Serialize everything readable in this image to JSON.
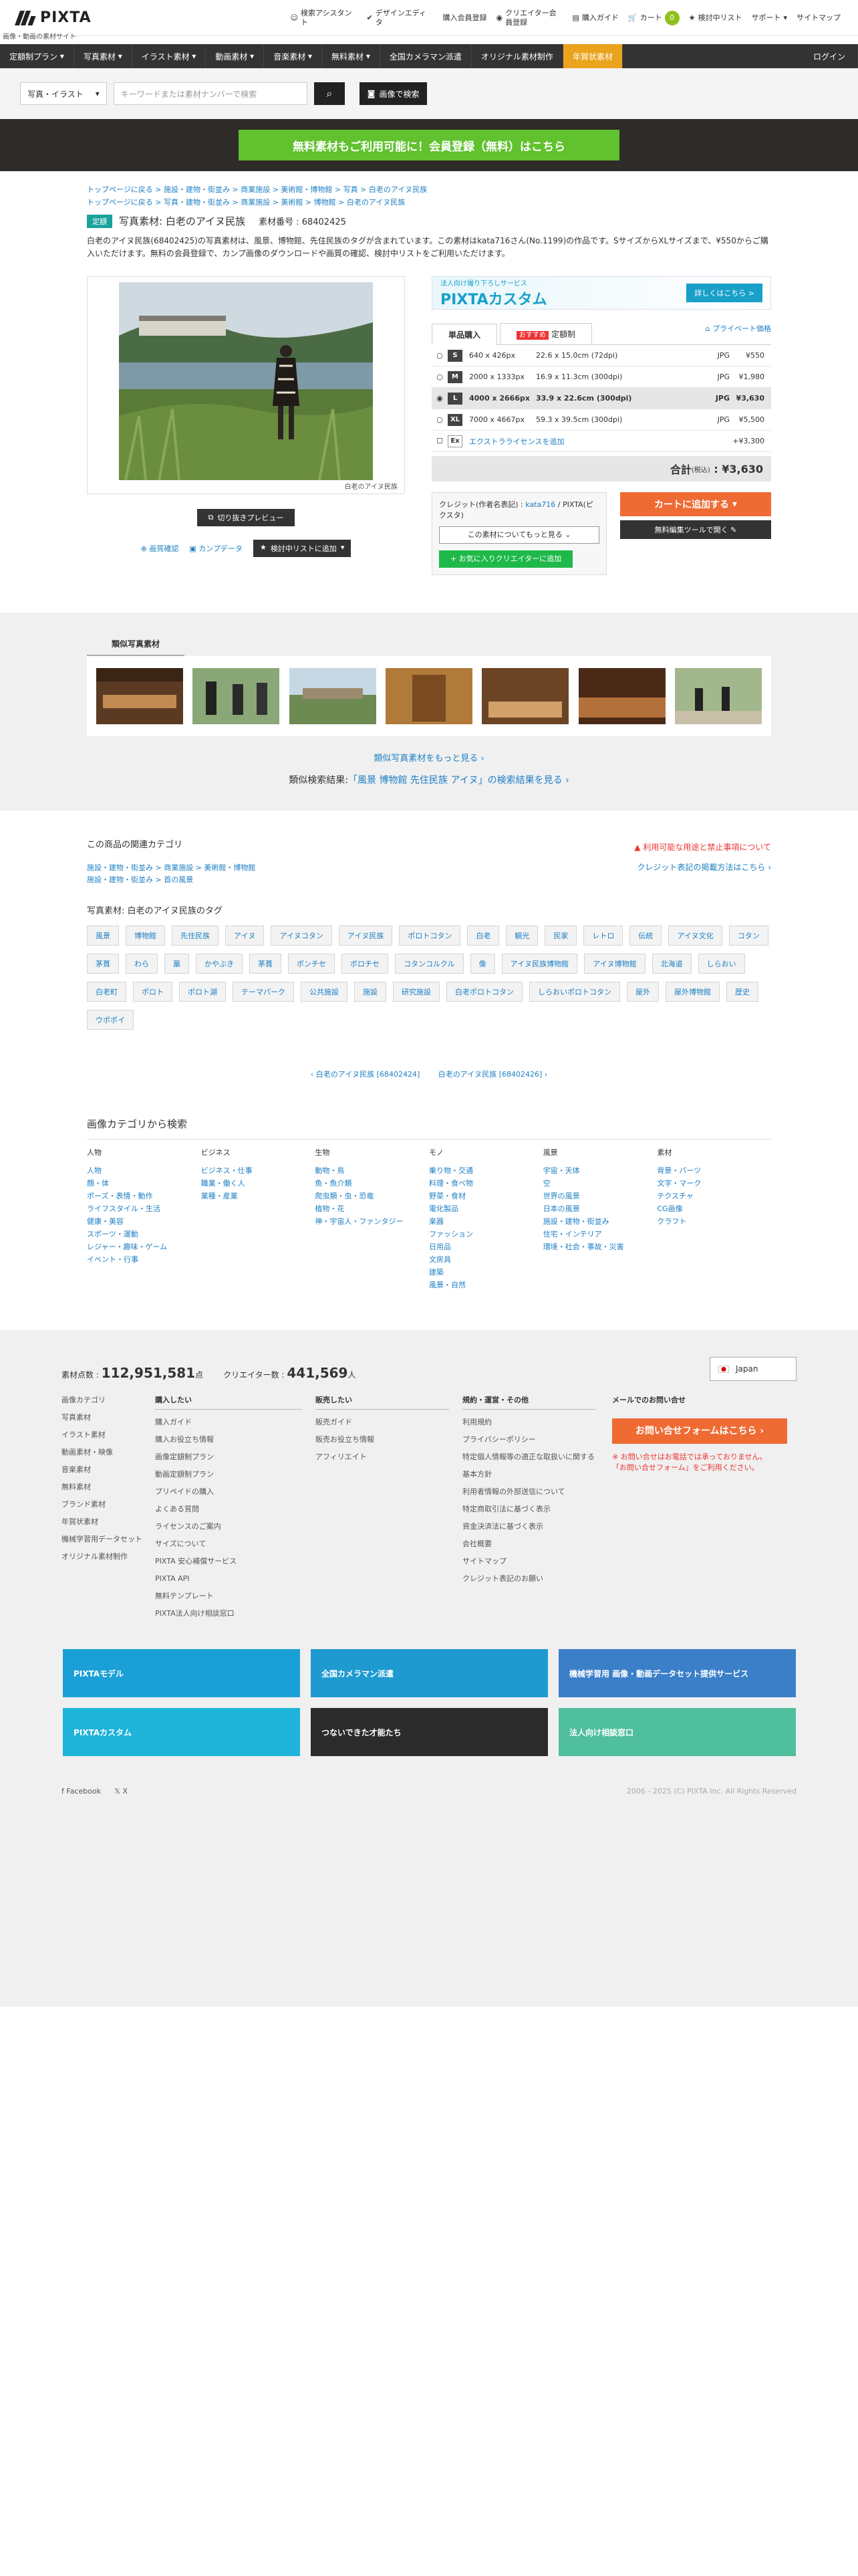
{
  "header": {
    "brand": "PIXTA",
    "tagline": "画像・動画の素材サイト",
    "nav": [
      {
        "icon": "assistant-icon",
        "label": "検索アシスタント"
      },
      {
        "icon": "check-icon",
        "label": "デザインエディタ"
      },
      {
        "icon": "",
        "label": "購入会員登録"
      },
      {
        "icon": "camera-icon",
        "label": "クリエイター会員登録"
      },
      {
        "icon": "guide-icon",
        "label": "購入ガイド"
      },
      {
        "icon": "cart-icon",
        "label": "カート"
      },
      {
        "icon": "star-icon",
        "label": "検討中リスト"
      },
      {
        "icon": "",
        "label": "サポート"
      },
      {
        "icon": "",
        "label": "サイトマップ"
      }
    ],
    "cart_count": "0"
  },
  "catnav": {
    "items": [
      "定額制プラン",
      "写真素材",
      "イラスト素材",
      "動画素材",
      "音楽素材",
      "無料素材",
      "全国カメラマン派遣",
      "オリジナル素材制作",
      "年賀状素材"
    ],
    "login": "ログイン"
  },
  "search": {
    "type": "写真・イラスト",
    "placeholder": "キーワードまたは素材ナンバーで検索",
    "image_search": "画像で検索"
  },
  "banner": {
    "text": "無料素材もご利用可能に！会員登録（無料）はこちら"
  },
  "breadcrumbs": [
    "トップページに戻る > 施設・建物・街並み > 商業施設 > 美術館・博物館 > 写真 > 白老のアイヌ民族",
    "トップページに戻る > 写真・建物・街並み > 商業施設 > 美術館 > 博物館 > 白老のアイヌ民族"
  ],
  "title": {
    "badge": "定額",
    "text": "写真素材: 白老のアイヌ民族",
    "number": "素材番号 : 68402425"
  },
  "description": "白老のアイヌ民族(68402425)の写真素材は、風景、博物館、先住民族のタグが含まれています。この素材はkata716さん(No.1199)の作品です。SサイズからXLサイズまで、¥550からご購入いただけます。無料の会員登録で、カンプ画像のダウンロードや画質の確認、検討中リストをご利用いただけます。",
  "image": {
    "caption": "白老のアイヌ民族",
    "preview": "切り抜きプレビュー",
    "quality": "画質確認",
    "comp": "カンプデータ",
    "add_list": "検討中リストに追加"
  },
  "custom": {
    "small": "法人向け撮り下ろしサービス",
    "title": "PIXTAカスタム",
    "btn": "詳しくはこちら >"
  },
  "tabs": {
    "single": "単品購入",
    "rec": "おすすめ",
    "subscription": "定額制",
    "private": "プライベート価格"
  },
  "sizes": [
    {
      "s": "S",
      "px": "640 x 426px",
      "cm": "22.6 x 15.0cm (72dpi)",
      "fmt": "JPG",
      "price": "¥550"
    },
    {
      "s": "M",
      "px": "2000 x 1333px",
      "cm": "16.9 x 11.3cm (300dpi)",
      "fmt": "JPG",
      "price": "¥1,980"
    },
    {
      "s": "L",
      "px": "4000 x 2666px",
      "cm": "33.9 x 22.6cm (300dpi)",
      "fmt": "JPG",
      "price": "¥3,630"
    },
    {
      "s": "XL",
      "px": "7000 x 4667px",
      "cm": "59.3 x 39.5cm (300dpi)",
      "fmt": "JPG",
      "price": "¥5,500"
    }
  ],
  "extra": {
    "s": "Ex",
    "label": "エクストラライセンスを追加",
    "price": "+¥3,300"
  },
  "total": {
    "label": "合計",
    "tax": "(税込)",
    "value": "¥3,630"
  },
  "credit": {
    "label": "クレジット(作者名表記) :",
    "name": "kata716",
    "suffix": "/ PIXTA(ピクスタ)",
    "more": "この素材についてもっと見る",
    "fav": "お気に入りクリエイターに追加"
  },
  "cart": {
    "add": "カートに追加する",
    "edit": "無料編集ツールで開く"
  },
  "similar": {
    "title": "類似写真素材",
    "more": "類似写真素材をもっと見る ›",
    "result_pre": "類似検索結果:",
    "result_link": "「風景 博物館 先住民族 アイヌ」の検索結果を見る ›"
  },
  "related": {
    "title": "この商品の関連カテゴリ",
    "links": [
      "施設・建物・街並み > 商業施設 > 美術館・博物館",
      "施設・建物・街並み > 首の風景"
    ],
    "notice": "利用可能な用途と禁止事項について",
    "credit_info": "クレジット表記の掲載方法はこちら ›"
  },
  "tags": {
    "title": "写真素材: 白老のアイヌ民族のタグ",
    "items": [
      "風景",
      "博物館",
      "先住民族",
      "アイヌ",
      "アイヌコタン",
      "アイヌ民族",
      "ポロトコタン",
      "白老",
      "観光",
      "民家",
      "レトロ",
      "伝統",
      "アイヌ文化",
      "コタン",
      "茅葺",
      "わら",
      "藁",
      "かやぶき",
      "茅葺",
      "ポンチセ",
      "ポロチセ",
      "コタンコルクル",
      "像",
      "アイヌ民族博物館",
      "アイヌ博物館",
      "北海道",
      "しらおい",
      "白老町",
      "ポロト",
      "ポロト湖",
      "テーマパーク",
      "公共施設",
      "施設",
      "研究施設",
      "白老ポロトコタン",
      "しらおいポロトコタン",
      "屋外",
      "屋外博物館",
      "歴史",
      "ウポポイ"
    ]
  },
  "pagination": {
    "prev": "‹ 白老のアイヌ民族 [68402424]",
    "next": "白老のアイヌ民族 [68402426] ›"
  },
  "categories": {
    "title": "画像カテゴリから検索",
    "cols": [
      {
        "h": "人物",
        "items": [
          "人物",
          "顔・体",
          "ポーズ・表情・動作",
          "ライフスタイル・生活",
          "健康・美容",
          "スポーツ・運動",
          "レジャー・趣味・ゲーム",
          "イベント・行事"
        ]
      },
      {
        "h": "ビジネス",
        "items": [
          "ビジネス・仕事",
          "職業・働く人",
          "業種・産業"
        ]
      },
      {
        "h": "生物",
        "items": [
          "動物・鳥",
          "魚・魚介類",
          "爬虫類・虫・恐竜",
          "植物・花",
          "神・宇宙人・ファンタジー"
        ]
      },
      {
        "h": "モノ",
        "items": [
          "乗り物・交通",
          "料理・食べ物",
          "野菜・食材",
          "電化製品",
          "楽器",
          "ファッション",
          "日用品",
          "文房具",
          "建築",
          "風景・自然"
        ]
      },
      {
        "h": "風景",
        "items": [
          "宇宙・天体",
          "空",
          "世界の風景",
          "日本の風景",
          "施設・建物・街並み",
          "住宅・インテリア",
          "環境・社会・事故・災害"
        ]
      },
      {
        "h": "素材",
        "items": [
          "背景・パーツ",
          "文字・マーク",
          "テクスチャ",
          "CG画像",
          "クラフト"
        ]
      }
    ]
  },
  "footer": {
    "count_label": "素材点数 :",
    "count": "112,951,581",
    "count_unit": "点",
    "creators_label": "クリエイター数 :",
    "creators": "441,569",
    "creators_unit": "人",
    "lang": "Japan",
    "col0": [
      "画像カテゴリ",
      "写真素材",
      "イラスト素材",
      "動画素材・映像",
      "音楽素材",
      "無料素材",
      "ブランド素材",
      "年賀状素材",
      "機械学習用データセット",
      "オリジナル素材制作"
    ],
    "buy_h": "購入したい",
    "buy": [
      "購入ガイド",
      "購入お役立ち情報",
      "画像定額制プラン",
      "動画定額制プラン",
      "プリペイドの購入",
      "よくある質問",
      "ライセンスのご案内",
      "サイズについて",
      "PIXTA 安心補償サービス",
      "PIXTA API",
      "無料テンプレート",
      "PIXTA法人向け相談窓口"
    ],
    "sell_h": "販売したい",
    "sell": [
      "販売ガイド",
      "販売お役立ち情報",
      "アフィリエイト"
    ],
    "rules_h": "規約・運営・その他",
    "rules": [
      "利用規約",
      "プライバシーポリシー",
      "特定個人情報等の適正な取扱いに関する基本方針",
      "利用者情報の外部送信について",
      "特定商取引法に基づく表示",
      "資金決済法に基づく表示",
      "会社概要",
      "サイトマップ",
      "クレジット表記のお願い"
    ],
    "contact_h": "メールでのお問い合せ",
    "contact_btn": "お問い合せフォームはこちら ›",
    "note1": "※ お問い合せはお電話では承っておりません。",
    "note2": "「お問い合せフォーム」をご利用ください。",
    "facebook": "Facebook",
    "x": "X",
    "copyright": "2006 - 2025 (C) PIXTA Inc. All Rights Reserved"
  },
  "ads": [
    {
      "text": "PIXTAモデル",
      "bg": "#1aa0d6"
    },
    {
      "text": "全国カメラマン派遣",
      "bg": "#1e9ad0"
    },
    {
      "text": "機械学習用 画像・動画データセット提供サービス",
      "bg": "#3b7fc9"
    },
    {
      "text": "PIXTAカスタム",
      "bg": "#1eb3d9"
    },
    {
      "text": "つないできた才能たち",
      "bg": "#2b2b2b"
    },
    {
      "text": "法人向け相談窓口",
      "bg": "#4fbf9d"
    }
  ]
}
